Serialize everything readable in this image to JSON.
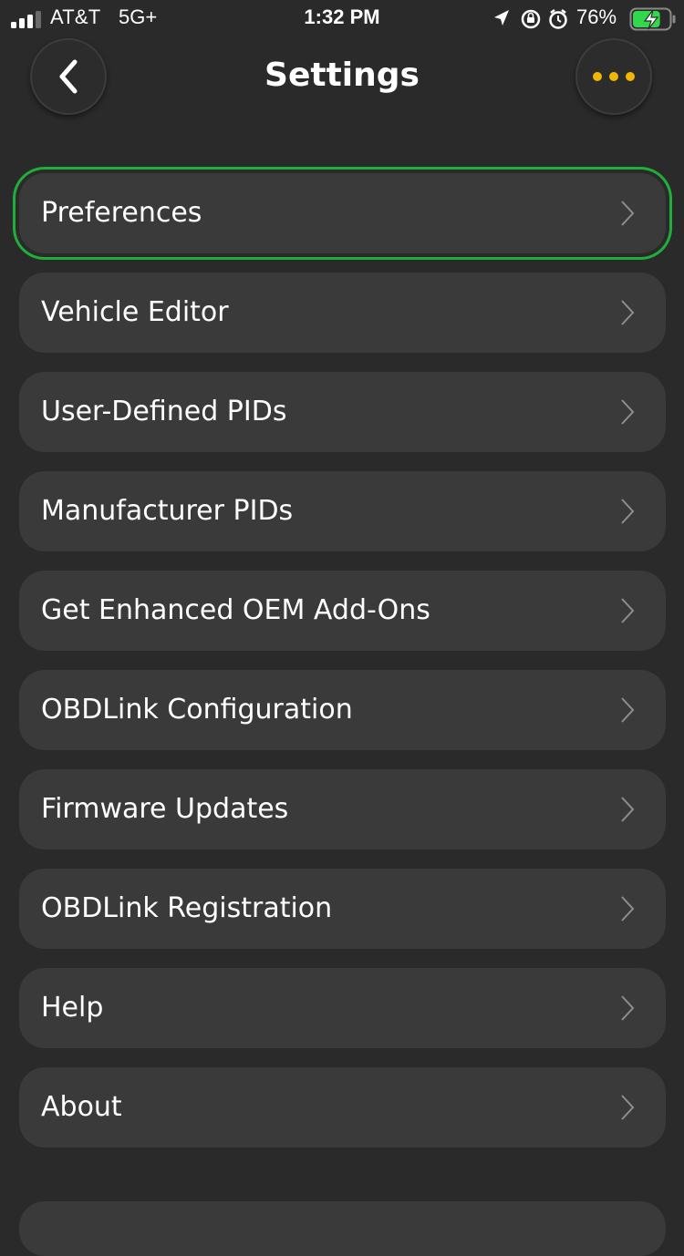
{
  "status_bar": {
    "carrier": "AT&T",
    "network": "5G+",
    "time": "1:32 PM",
    "battery_percent": "76%",
    "battery_level": 0.76
  },
  "header": {
    "title": "Settings",
    "back_icon": "chevron-left-icon",
    "more_icon": "ellipsis-icon",
    "accent_color": "#f2b705"
  },
  "menu": {
    "selected_index": 0,
    "selection_color": "#1fae3c",
    "items": [
      {
        "label": "Preferences"
      },
      {
        "label": "Vehicle Editor"
      },
      {
        "label": "User-Defined PIDs"
      },
      {
        "label": "Manufacturer PIDs"
      },
      {
        "label": "Get Enhanced OEM Add-Ons"
      },
      {
        "label": "OBDLink Configuration"
      },
      {
        "label": "Firmware Updates"
      },
      {
        "label": "OBDLink Registration"
      },
      {
        "label": "Help"
      },
      {
        "label": "About"
      }
    ]
  }
}
